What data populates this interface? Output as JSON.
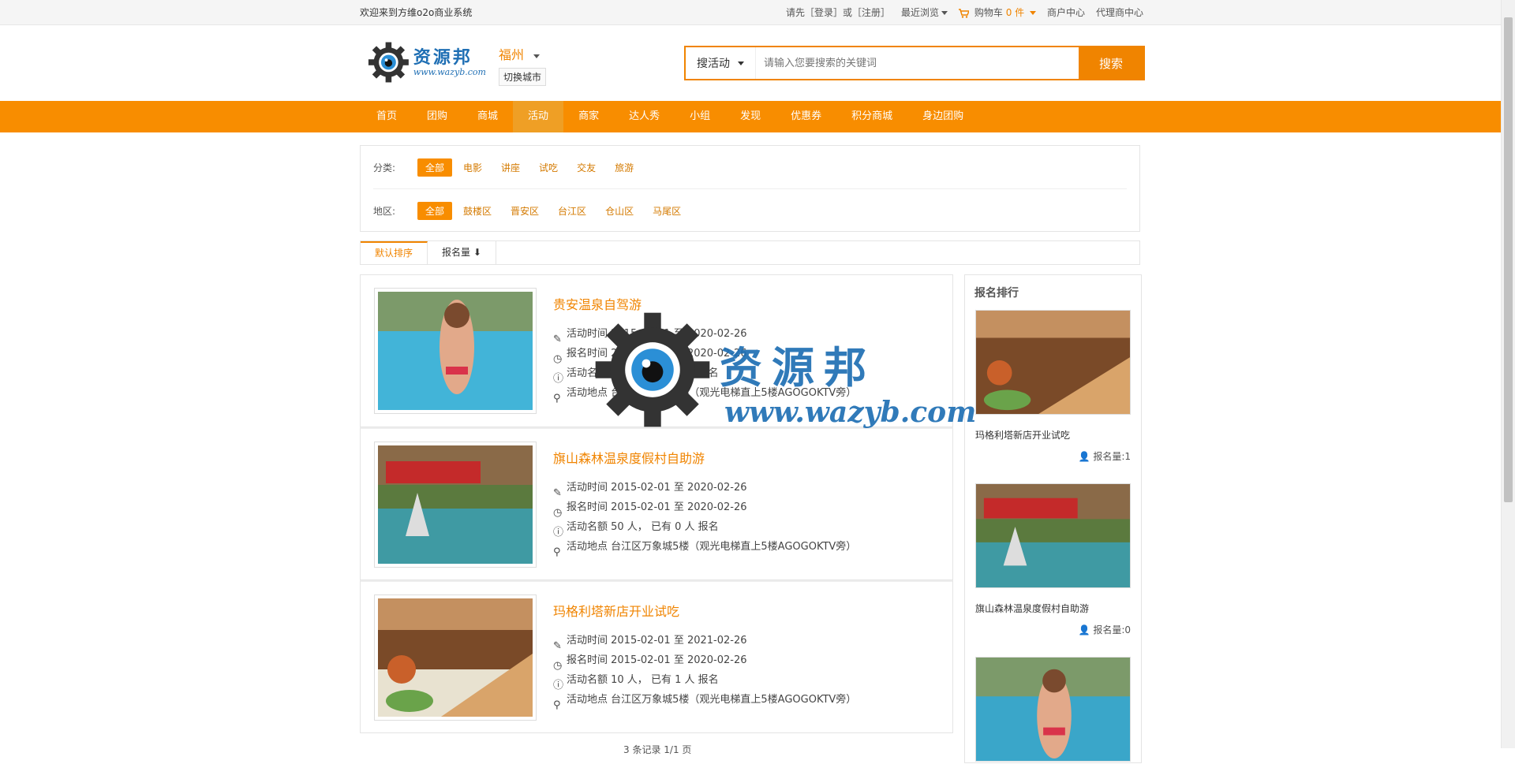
{
  "topbar": {
    "welcome": "欢迎来到方维o2o商业系统",
    "login_prompt": "请先［登录］或［注册］",
    "recent": "最近浏览",
    "cart_label": "购物车",
    "cart_count": "0 件",
    "merchant_center": "商户中心",
    "agent_center": "代理商中心"
  },
  "header": {
    "logo_cn": "资源邦",
    "logo_en": "www.wazyb.com",
    "city": "福州",
    "city_switch": "切换城市",
    "search_type": "搜活动",
    "search_placeholder": "请输入您要搜索的关键词",
    "search_button": "搜索"
  },
  "nav": [
    "首页",
    "团购",
    "商城",
    "活动",
    "商家",
    "达人秀",
    "小组",
    "发现",
    "优惠券",
    "积分商城",
    "身边团购"
  ],
  "filter": {
    "category_label": "分类:",
    "categories": [
      "全部",
      "电影",
      "讲座",
      "试吃",
      "交友",
      "旅游"
    ],
    "region_label": "地区:",
    "regions": [
      "全部",
      "鼓楼区",
      "晋安区",
      "台江区",
      "仓山区",
      "马尾区"
    ]
  },
  "sort": {
    "default": "默认排序",
    "signups": "报名量"
  },
  "events": [
    {
      "title": "贵安温泉自驾游",
      "activity_time": "活动时间 2015-02-01 至 2020-02-26",
      "signup_time": "报名时间 2015-02-01 至 2020-02-26",
      "quota": "活动名额 10 人，  已有 0 人 报名",
      "location": "活动地点 台江区万象城5楼（观光电梯直上5楼AGOGOKTV旁）"
    },
    {
      "title": "旗山森林温泉度假村自助游",
      "activity_time": "活动时间 2015-02-01 至 2020-02-26",
      "signup_time": "报名时间 2015-02-01 至 2020-02-26",
      "quota": "活动名额 50 人，  已有 0 人 报名",
      "location": "活动地点 台江区万象城5楼（观光电梯直上5楼AGOGOKTV旁）"
    },
    {
      "title": "玛格利塔新店开业试吃",
      "activity_time": "活动时间 2015-02-01 至 2021-02-26",
      "signup_time": "报名时间 2015-02-01 至 2020-02-26",
      "quota": "活动名额 10 人，  已有 1 人 报名",
      "location": "活动地点 台江区万象城5楼（观光电梯直上5楼AGOGOKTV旁）"
    }
  ],
  "sidebar": {
    "title": "报名排行",
    "items": [
      {
        "name": "玛格利塔新店开业试吃",
        "count": "报名量:1"
      },
      {
        "name": "旗山森林温泉度假村自助游",
        "count": "报名量:0"
      },
      {
        "name": "",
        "count": ""
      }
    ]
  },
  "watermark": {
    "cn": "资源邦",
    "en": "www.wazyb.com"
  },
  "footer_partial": "3 条记录 1/1 页",
  "colors": {
    "accent": "#f88d00",
    "brand_blue": "#1f6fb4"
  }
}
